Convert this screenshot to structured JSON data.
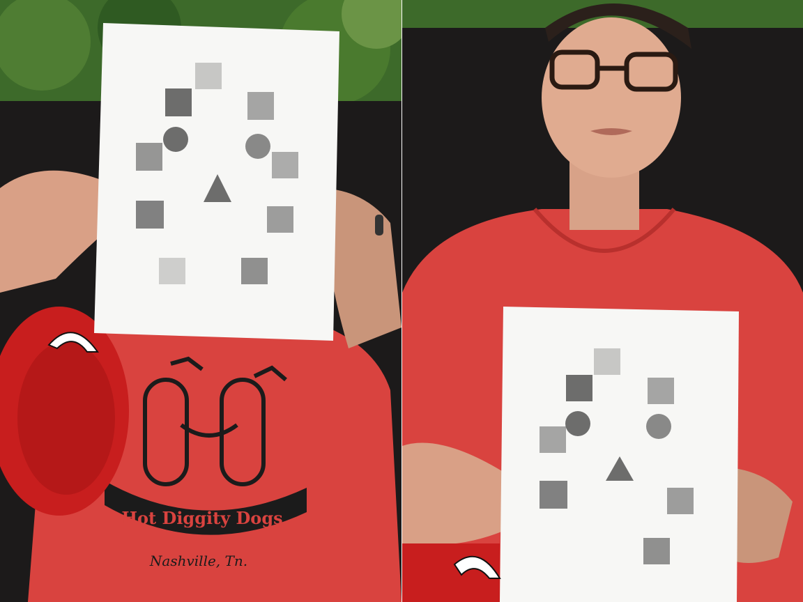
{
  "photo": {
    "left_panel": {
      "shirt_print": {
        "banner_text": "Hot Diggity Dogs",
        "city_text": "Nashville, Tn."
      }
    }
  },
  "colors": {
    "shirt_red": "#d9433f",
    "cap_red": "#c81e1e",
    "backdrop_black": "#1c1a1a",
    "foliage_green": "#3d6a2a",
    "paper_white": "#f7f7f5",
    "print_gray": "#555555"
  }
}
